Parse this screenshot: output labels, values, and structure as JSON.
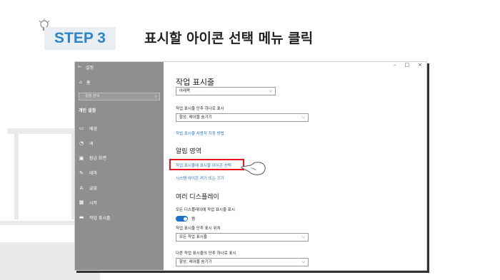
{
  "header": {
    "step": "STEP 3",
    "title": "표시할 아이콘 선택 메뉴 클릭"
  },
  "colors": {
    "step_accent": "#2b86c7",
    "highlight_border": "#e8131c",
    "link": "#1a73c9",
    "sidebar_bg": "#8f8f8f"
  },
  "window": {
    "back_icon": "←",
    "title": "설정",
    "controls": [
      "–",
      "□",
      "×"
    ]
  },
  "sidebar": {
    "home": "홈",
    "search_placeholder": "설정 검색",
    "section": "개인 설정",
    "items": [
      {
        "icon": "background-icon",
        "label": "배경"
      },
      {
        "icon": "colors-icon",
        "label": "색"
      },
      {
        "icon": "lock-screen-icon",
        "label": "잠금 화면"
      },
      {
        "icon": "themes-icon",
        "label": "테마"
      },
      {
        "icon": "fonts-icon",
        "label": "글꼴"
      },
      {
        "icon": "start-icon",
        "label": "시작"
      },
      {
        "icon": "taskbar-icon",
        "label": "작업 표시줄"
      }
    ]
  },
  "main": {
    "title": "작업 표시줄",
    "dropdown_top": "아래쪽",
    "combine_label": "작업 표시줄 단추 하나로 표시",
    "combine_value": "항상, 레이블 숨기기",
    "customize_link": "작업 표시줄 사용자 지정 방법",
    "notification_heading": "알림 영역",
    "select_icons_link": "작업 표시줄에 표시할 아이콘 선택",
    "system_icons_link": "시스템 아이콘 켜기 또는 끄기",
    "multi_heading": "여러 디스플레이",
    "show_all_label": "모든 디스플레이에 작업 표시줄 표시",
    "toggle_state": "켬",
    "position_label": "작업 표시줄 단추 표시 위치",
    "position_value": "모든 작업 표시줄",
    "other_combine_label": "다른 작업 표시줄의 단추 하나로 표시",
    "other_combine_value": "항상, 레이블 숨기기"
  }
}
